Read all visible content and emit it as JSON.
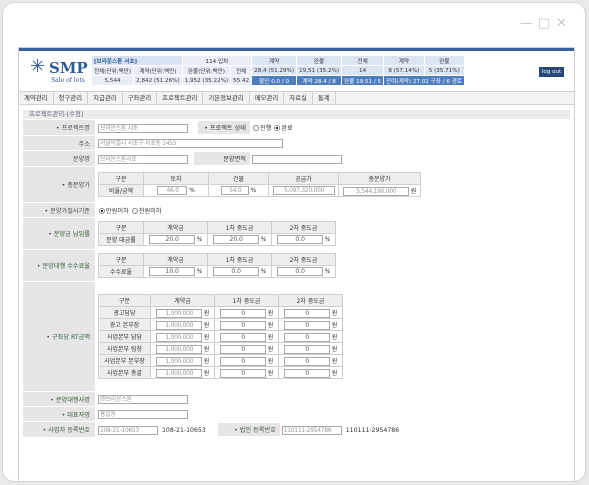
{
  "header": {
    "logo_text": "SMP",
    "logo_sub": "Sale of lots",
    "logout": "log out",
    "stats_row1": [
      "[브라운스톤 서초]",
      "",
      "114 입차",
      "",
      "계약",
      "",
      "완불",
      "",
      "전체",
      "",
      "계약",
      "",
      "완불"
    ],
    "stats_row2": [
      "전체(단위:백만)",
      "계약(단위:백만)",
      "완불(단위:백만)",
      "전체",
      "28,4 (51.29%)",
      "19,51 (35.2%)",
      "14",
      "8 (57.14%)",
      "5 (35.71%)"
    ],
    "stats_row3": [
      "5,544",
      "2,842 (51.26%)",
      "1,952 (35.22%)",
      "55.42",
      "할인 0.0 / 0",
      "계약 28.4 / 8",
      "완불 19.51 / 5",
      "잔여(계약) 27.02 구좌 / 6 경로"
    ]
  },
  "nav": [
    "계약관리",
    "청구관리",
    "지급관리",
    "구좌관리",
    "프로젝트관리",
    "기본정보관리",
    "메모관리",
    "자료실",
    "통계"
  ],
  "section_title": "프로젝트관리-[수정]",
  "labels": {
    "project_name": "• 프로젝트명",
    "project_status": "• 프로젝트 상태",
    "address": "주소",
    "sale_name": "분양명",
    "sale_area": "분양면적",
    "total_price": "• 총분양가",
    "price_threshold": "• 분양가절사기준",
    "payment_ratio": "• 분양금 납입률",
    "agency_fee": "• 분양대행 수수료율",
    "rt_amount": "• 구좌당 RT금액",
    "agency_company": "• 분양대행사명",
    "representative": "• 대표자명",
    "business_reg": "• 사업자 등록번호",
    "corp_reg": "• 법인 등록번호"
  },
  "values": {
    "project_name": "브라운스톤 서초",
    "status_options": [
      "진행",
      "완료"
    ],
    "address": "서울특별시 서초구 서초동 1455",
    "sale_name": "브라운스톤서초",
    "sale_area": "",
    "threshold_options": [
      "만원이하",
      "천원이하"
    ],
    "agency_company": "㈜브라운스톤",
    "representative": "홍길동",
    "business_reg_blur": "108-21-10653",
    "business_reg_suffix": "108-21-10653",
    "corp_reg_blur": "110111-2954786",
    "corp_reg_suffix": "110111-2954786"
  },
  "total_price_table": {
    "headers": [
      "구분",
      "토지",
      "건물",
      "공급가",
      "총분양가"
    ],
    "row_label": "비율/금액",
    "land": "46.0",
    "building": "54.0",
    "supply": "5,097,320,000",
    "total": "5,544,190,000",
    "unit_pct": "%",
    "unit_won": "원"
  },
  "payment_table": {
    "headers": [
      "구분",
      "계약금",
      "1차 중도금",
      "2차 중도금"
    ],
    "row_label": "분양 대금률",
    "values": [
      "20.0",
      "20.0",
      "0.0"
    ],
    "unit": "%"
  },
  "fee_table": {
    "headers": [
      "구분",
      "계약금",
      "1차 중도금",
      "2차 중도금"
    ],
    "row_label": "수수료율",
    "values": [
      "10.0",
      "0.0",
      "0.0"
    ],
    "unit": "%"
  },
  "rt_table": {
    "headers": [
      "구분",
      "계약금",
      "1차 중도금",
      "2차 중도금"
    ],
    "rows": [
      {
        "label": "광고담당",
        "values": [
          "1,000,000",
          "0",
          "0"
        ]
      },
      {
        "label": "광고 본부장",
        "values": [
          "1,000,000",
          "0",
          "0"
        ]
      },
      {
        "label": "사업본부 담당",
        "values": [
          "1,000,000",
          "0",
          "0"
        ]
      },
      {
        "label": "사업본부 팀장",
        "values": [
          "1,000,000",
          "0",
          "0"
        ]
      },
      {
        "label": "사업본부 본부장",
        "values": [
          "1,000,000",
          "0",
          "0"
        ]
      },
      {
        "label": "사업본부 총괄",
        "values": [
          "1,000,000",
          "0",
          "0"
        ]
      }
    ],
    "unit": "원"
  },
  "colors": {
    "brand": "#2d5c96",
    "nav_bg": "#f2f2f2",
    "label_bg": "#e6e6e6"
  }
}
